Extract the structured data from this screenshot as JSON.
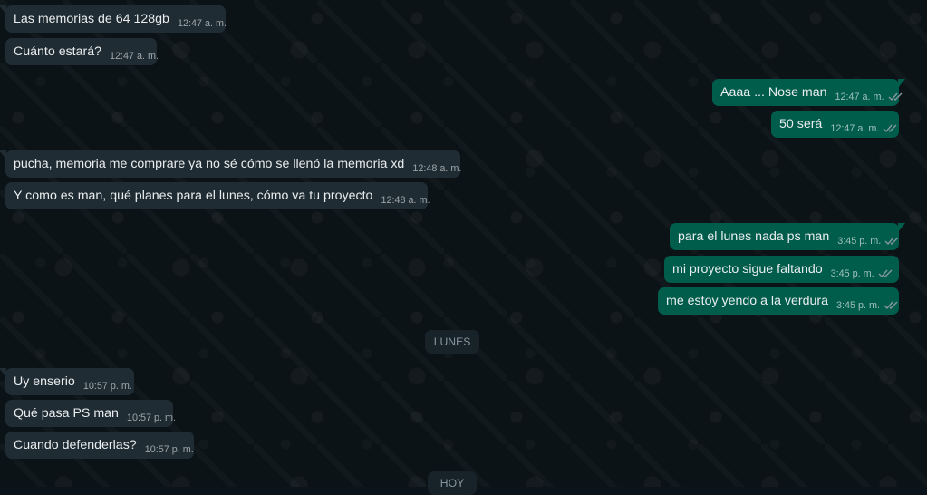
{
  "colors": {
    "background": "#0b141a",
    "incoming_bubble": "#202c33",
    "outgoing_bubble": "#005c4b",
    "text": "#e9edef",
    "meta_text": "#8696a0",
    "read_ticks": "#8696a0"
  },
  "messages": [
    {
      "text": "Las memorias de 64 128gb",
      "time": "12:47 a. m."
    },
    {
      "text": "Cuánto estará?",
      "time": "12:47 a. m."
    },
    {
      "text": "Aaaa ... Nose man",
      "time": "12:47 a. m.",
      "status_icon": "double-check-icon"
    },
    {
      "text": "50 será",
      "time": "12:47 a. m.",
      "status_icon": "double-check-icon"
    },
    {
      "text": "pucha, memoria me comprare ya no sé cómo se llenó la memoria xd",
      "time": "12:48 a. m."
    },
    {
      "text": "Y como es man, qué planes para el lunes, cómo va tu proyecto",
      "time": "12:48 a. m."
    },
    {
      "text": "para el lunes nada ps man",
      "time": "3:45 p. m.",
      "status_icon": "double-check-icon"
    },
    {
      "text": "mi proyecto sigue faltando",
      "time": "3:45 p. m.",
      "status_icon": "double-check-icon"
    },
    {
      "text": "me estoy yendo a la verdura",
      "time": "3:45 p. m.",
      "status_icon": "double-check-icon"
    },
    {
      "text": "Uy enserio",
      "time": "10:57 p. m."
    },
    {
      "text": "Qué pasa PS man",
      "time": "10:57 p. m."
    },
    {
      "text": "Cuando defenderlas?",
      "time": "10:57 p. m."
    }
  ],
  "date_separators": {
    "lunes": "LUNES",
    "hoy": "HOY"
  }
}
